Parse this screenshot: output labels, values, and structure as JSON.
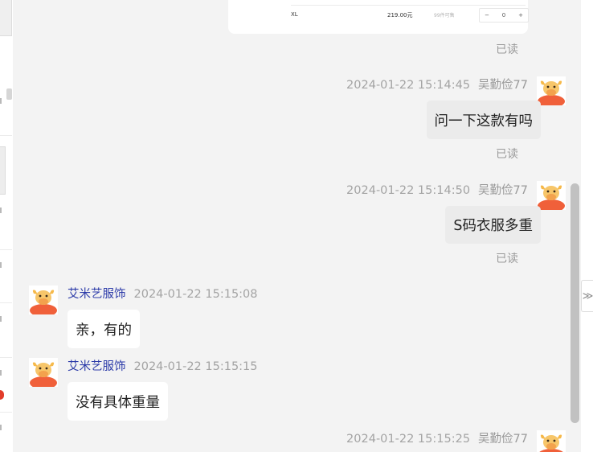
{
  "product_card": {
    "size": "XL",
    "price": "219.00元",
    "stock": "99件可售",
    "stepper": {
      "minus": "−",
      "quantity": "0",
      "plus": "+"
    }
  },
  "messages": [
    {
      "side": "right",
      "type": "read",
      "read_label": "已读"
    },
    {
      "side": "right",
      "sender": "吴勤俭77",
      "time": "2024-01-22 15:14:45",
      "text": "问一下这款有吗",
      "read_label": "已读"
    },
    {
      "side": "right",
      "sender": "吴勤俭77",
      "time": "2024-01-22 15:14:50",
      "text": "S码衣服多重",
      "read_label": "已读"
    },
    {
      "side": "left",
      "sender": "艾米艺服饰",
      "time": "2024-01-22 15:15:08",
      "text": "亲，有的"
    },
    {
      "side": "left",
      "sender": "艾米艺服饰",
      "time": "2024-01-22 15:15:15",
      "text": "没有具体重量"
    },
    {
      "side": "right",
      "sender": "吴勤俭77",
      "time": "2024-01-22 15:15:25"
    }
  ],
  "avatar_icon": "cartoon-bull-avatar",
  "collapse_icon": "double-chevron-right-icon",
  "collapse_glyph": "≫",
  "colors": {
    "chat_bg": "#f3f3f3",
    "sent_bubble": "#ebebeb",
    "recv_bubble": "#ffffff",
    "seller_name": "#2b3aa8",
    "meta_text": "#a3a3a3"
  }
}
